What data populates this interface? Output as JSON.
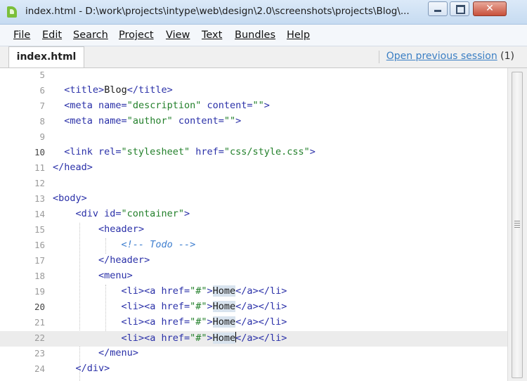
{
  "window": {
    "title": "index.html - D:\\work\\projects\\intype\\web\\design\\2.0\\screenshots\\projects\\Blog\\...",
    "close_glyph": "✕"
  },
  "menu": [
    "File",
    "Edit",
    "Search",
    "Project",
    "View",
    "Text",
    "Bundles",
    "Help"
  ],
  "tabs": {
    "active": "index.html",
    "session_link": "Open previous session",
    "session_count": "(1)"
  },
  "editor": {
    "current_line": "22",
    "lines": [
      {
        "n": "5",
        "text": ""
      },
      {
        "n": "6",
        "text": "<title>Blog</title>"
      },
      {
        "n": "7",
        "text": "<meta name=\"description\" content=\"\">"
      },
      {
        "n": "8",
        "text": "<meta name=\"author\" content=\"\">"
      },
      {
        "n": "9",
        "text": ""
      },
      {
        "n": "10",
        "text": "<link rel=\"stylesheet\" href=\"css/style.css\">"
      },
      {
        "n": "11",
        "text": "</head>"
      },
      {
        "n": "12",
        "text": ""
      },
      {
        "n": "13",
        "text": "<body>"
      },
      {
        "n": "14",
        "text": "<div id=\"container\">"
      },
      {
        "n": "15",
        "text": "<header>"
      },
      {
        "n": "16",
        "text": "<!-- Todo -->"
      },
      {
        "n": "17",
        "text": "</header>"
      },
      {
        "n": "18",
        "text": "<menu>"
      },
      {
        "n": "19",
        "text": "<li><a href=\"#\">Home</a></li>"
      },
      {
        "n": "20",
        "text": "<li><a href=\"#\">Home</a></li>"
      },
      {
        "n": "21",
        "text": "<li><a href=\"#\">Home</a></li>"
      },
      {
        "n": "22",
        "text": "<li><a href=\"#\">Home</a></li>"
      },
      {
        "n": "23",
        "text": "</menu>"
      },
      {
        "n": "24",
        "text": "</div>"
      }
    ]
  },
  "colors": {
    "tag": "#2a30a8",
    "string": "#23802b",
    "comment": "#3f7fcf",
    "selection": "#d8e3ee",
    "current_line": "#ececec",
    "link": "#3b7fc4"
  },
  "icons": {
    "app": "intype-app-icon",
    "minimize": "minimize-icon",
    "maximize": "maximize-icon",
    "close": "close-icon"
  }
}
